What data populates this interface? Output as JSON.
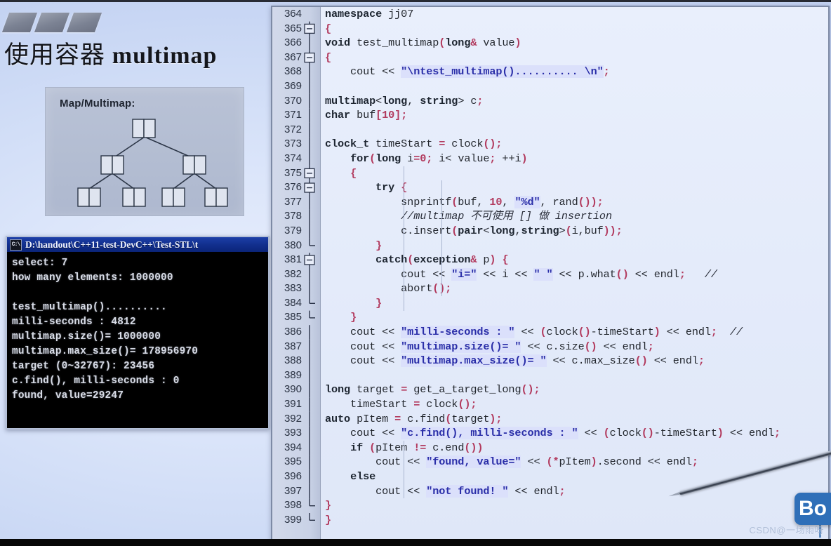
{
  "slide": {
    "title_cn": "使用容器 ",
    "title_en": "multimap",
    "diagram": {
      "label": "Map/Multimap:"
    }
  },
  "console": {
    "icon": "console-icon",
    "title": "D:\\handout\\C++11-test-DevC++\\Test-STL\\t",
    "output": "select: 7\nhow many elements: 1000000\n\ntest_multimap()..........\nmilli-seconds : 4812\nmultimap.size()= 1000000\nmultimap.max_size()= 178956970\ntarget (0~32767): 23456\nc.find(), milli-seconds : 0\nfound, value=29247"
  },
  "editor": {
    "first_line": 364,
    "lines": [
      {
        "n": 364,
        "fold": "none",
        "text": "namespace jj07"
      },
      {
        "n": 365,
        "fold": "open",
        "text": "{"
      },
      {
        "n": 366,
        "fold": "bar",
        "text": "void test_multimap(long& value)"
      },
      {
        "n": 367,
        "fold": "open",
        "text": "{"
      },
      {
        "n": 368,
        "fold": "bar",
        "text": "    cout << \"\\ntest_multimap().......... \\n\";"
      },
      {
        "n": 369,
        "fold": "bar",
        "text": ""
      },
      {
        "n": 370,
        "fold": "bar",
        "text": "multimap<long, string> c;"
      },
      {
        "n": 371,
        "fold": "bar",
        "text": "char buf[10];"
      },
      {
        "n": 372,
        "fold": "bar",
        "text": ""
      },
      {
        "n": 373,
        "fold": "bar",
        "text": "clock_t timeStart = clock();"
      },
      {
        "n": 374,
        "fold": "bar",
        "text": "    for(long i=0; i< value; ++i)"
      },
      {
        "n": 375,
        "fold": "open",
        "text": "    {"
      },
      {
        "n": 376,
        "fold": "open",
        "text": "        try {"
      },
      {
        "n": 377,
        "fold": "bar",
        "text": "            snprintf(buf, 10, \"%d\", rand());"
      },
      {
        "n": 378,
        "fold": "bar",
        "text": "            //multimap 不可使用 [] 做 insertion"
      },
      {
        "n": 379,
        "fold": "bar",
        "text": "            c.insert(pair<long,string>(i,buf));"
      },
      {
        "n": 380,
        "fold": "end",
        "text": "        }"
      },
      {
        "n": 381,
        "fold": "open",
        "text": "        catch(exception& p) {"
      },
      {
        "n": 382,
        "fold": "bar",
        "text": "            cout << \"i=\" << i << \" \" << p.what() << endl;   //"
      },
      {
        "n": 383,
        "fold": "bar",
        "text": "            abort();"
      },
      {
        "n": 384,
        "fold": "end",
        "text": "        }"
      },
      {
        "n": 385,
        "fold": "end",
        "text": "    }"
      },
      {
        "n": 386,
        "fold": "bar",
        "text": "    cout << \"milli-seconds : \" << (clock()-timeStart) << endl;  //"
      },
      {
        "n": 387,
        "fold": "bar",
        "text": "    cout << \"multimap.size()= \" << c.size() << endl;"
      },
      {
        "n": 388,
        "fold": "bar",
        "text": "    cout << \"multimap.max_size()= \" << c.max_size() << endl;"
      },
      {
        "n": 389,
        "fold": "bar",
        "text": ""
      },
      {
        "n": 390,
        "fold": "bar",
        "text": "long target = get_a_target_long();"
      },
      {
        "n": 391,
        "fold": "bar",
        "text": "    timeStart = clock();"
      },
      {
        "n": 392,
        "fold": "bar",
        "text": "auto pItem = c.find(target);"
      },
      {
        "n": 393,
        "fold": "bar",
        "text": "    cout << \"c.find(), milli-seconds : \" << (clock()-timeStart) << endl;"
      },
      {
        "n": 394,
        "fold": "bar",
        "text": "    if (pItem != c.end())"
      },
      {
        "n": 395,
        "fold": "bar",
        "text": "        cout << \"found, value=\" << (*pItem).second << endl;"
      },
      {
        "n": 396,
        "fold": "bar",
        "text": "    else"
      },
      {
        "n": 397,
        "fold": "bar",
        "text": "        cout << \"not found! \" << endl;"
      },
      {
        "n": 398,
        "fold": "end",
        "text": "}"
      },
      {
        "n": 399,
        "fold": "end",
        "text": "}"
      }
    ]
  },
  "overlay": {
    "badge_label": "Bo",
    "watermark": "CSDN@一场雨呀",
    "pointer": "laser-pointer"
  },
  "colors": {
    "slide_bg": "#dbe5fa",
    "editor_bg": "#e6ecfb",
    "gutter_bg": "#c9d2e6",
    "console_title": "#12308f",
    "string": "#2a2ea8",
    "punct": "#b23a5e",
    "badge": "#2f6fb8",
    "tree_panel": "#b3bdd2"
  }
}
